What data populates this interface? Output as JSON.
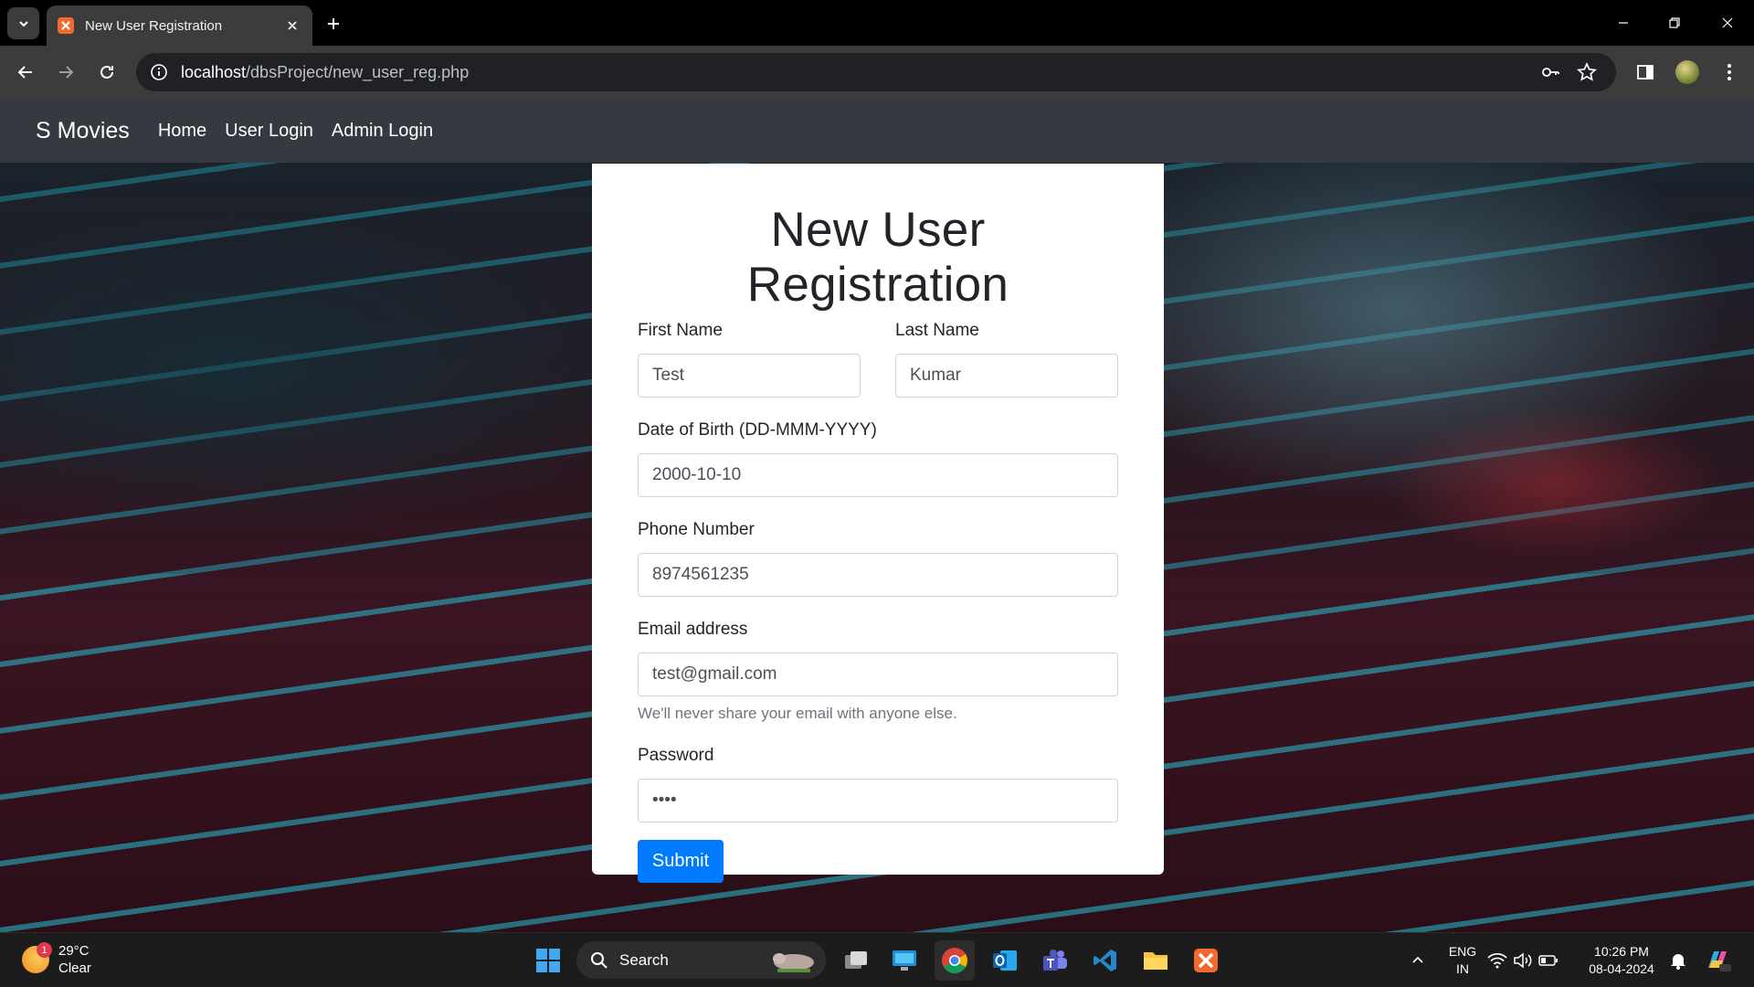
{
  "browser": {
    "tab_title": "New User Registration",
    "url_host": "localhost",
    "url_path": "/dbsProject/new_user_reg.php"
  },
  "navbar": {
    "brand": "S Movies",
    "links": [
      "Home",
      "User Login",
      "Admin Login"
    ]
  },
  "form": {
    "title": "New User Registration",
    "first_name_label": "First Name",
    "first_name_value": "Test",
    "last_name_label": "Last Name",
    "last_name_value": "Kumar",
    "dob_label": "Date of Birth (DD-MMM-YYYY)",
    "dob_value": "2000-10-10",
    "phone_label": "Phone Number",
    "phone_value": "8974561235",
    "email_label": "Email address",
    "email_value": "test@gmail.com",
    "email_help": "We'll never share your email with anyone else.",
    "password_label": "Password",
    "password_value": "••••",
    "submit_label": "Submit"
  },
  "colors": {
    "navbar_bg": "#343a40",
    "primary_button": "#007bff"
  },
  "taskbar": {
    "weather_temp": "29°C",
    "weather_desc": "Clear",
    "weather_badge": "1",
    "search_label": "Search",
    "lang_top": "ENG",
    "lang_bottom": "IN",
    "time": "10:26 PM",
    "date": "08-04-2024"
  }
}
